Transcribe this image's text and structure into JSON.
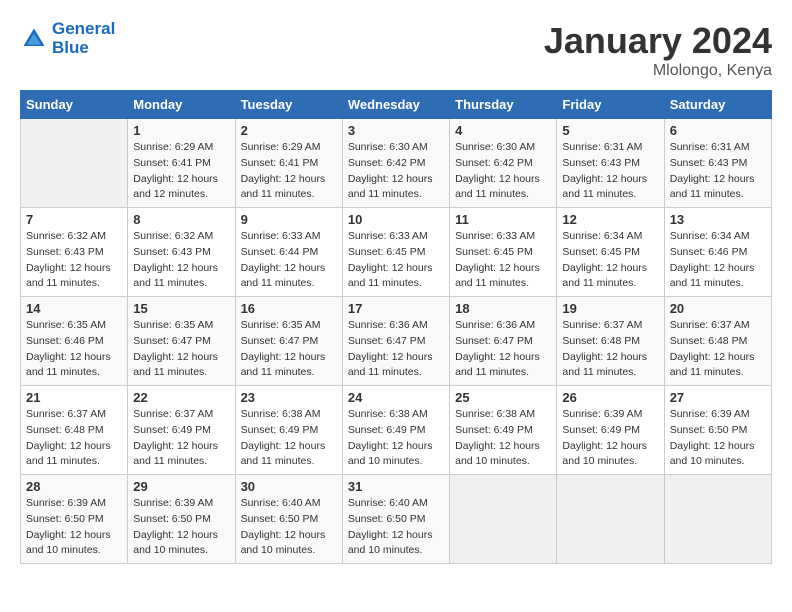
{
  "header": {
    "logo_line1": "General",
    "logo_line2": "Blue",
    "month": "January 2024",
    "location": "Mlolongo, Kenya"
  },
  "columns": [
    "Sunday",
    "Monday",
    "Tuesday",
    "Wednesday",
    "Thursday",
    "Friday",
    "Saturday"
  ],
  "weeks": [
    [
      {
        "day": "",
        "sunrise": "",
        "sunset": "",
        "daylight": ""
      },
      {
        "day": "1",
        "sunrise": "Sunrise: 6:29 AM",
        "sunset": "Sunset: 6:41 PM",
        "daylight": "Daylight: 12 hours and 12 minutes."
      },
      {
        "day": "2",
        "sunrise": "Sunrise: 6:29 AM",
        "sunset": "Sunset: 6:41 PM",
        "daylight": "Daylight: 12 hours and 11 minutes."
      },
      {
        "day": "3",
        "sunrise": "Sunrise: 6:30 AM",
        "sunset": "Sunset: 6:42 PM",
        "daylight": "Daylight: 12 hours and 11 minutes."
      },
      {
        "day": "4",
        "sunrise": "Sunrise: 6:30 AM",
        "sunset": "Sunset: 6:42 PM",
        "daylight": "Daylight: 12 hours and 11 minutes."
      },
      {
        "day": "5",
        "sunrise": "Sunrise: 6:31 AM",
        "sunset": "Sunset: 6:43 PM",
        "daylight": "Daylight: 12 hours and 11 minutes."
      },
      {
        "day": "6",
        "sunrise": "Sunrise: 6:31 AM",
        "sunset": "Sunset: 6:43 PM",
        "daylight": "Daylight: 12 hours and 11 minutes."
      }
    ],
    [
      {
        "day": "7",
        "sunrise": "Sunrise: 6:32 AM",
        "sunset": "Sunset: 6:43 PM",
        "daylight": "Daylight: 12 hours and 11 minutes."
      },
      {
        "day": "8",
        "sunrise": "Sunrise: 6:32 AM",
        "sunset": "Sunset: 6:43 PM",
        "daylight": "Daylight: 12 hours and 11 minutes."
      },
      {
        "day": "9",
        "sunrise": "Sunrise: 6:33 AM",
        "sunset": "Sunset: 6:44 PM",
        "daylight": "Daylight: 12 hours and 11 minutes."
      },
      {
        "day": "10",
        "sunrise": "Sunrise: 6:33 AM",
        "sunset": "Sunset: 6:45 PM",
        "daylight": "Daylight: 12 hours and 11 minutes."
      },
      {
        "day": "11",
        "sunrise": "Sunrise: 6:33 AM",
        "sunset": "Sunset: 6:45 PM",
        "daylight": "Daylight: 12 hours and 11 minutes."
      },
      {
        "day": "12",
        "sunrise": "Sunrise: 6:34 AM",
        "sunset": "Sunset: 6:45 PM",
        "daylight": "Daylight: 12 hours and 11 minutes."
      },
      {
        "day": "13",
        "sunrise": "Sunrise: 6:34 AM",
        "sunset": "Sunset: 6:46 PM",
        "daylight": "Daylight: 12 hours and 11 minutes."
      }
    ],
    [
      {
        "day": "14",
        "sunrise": "Sunrise: 6:35 AM",
        "sunset": "Sunset: 6:46 PM",
        "daylight": "Daylight: 12 hours and 11 minutes."
      },
      {
        "day": "15",
        "sunrise": "Sunrise: 6:35 AM",
        "sunset": "Sunset: 6:47 PM",
        "daylight": "Daylight: 12 hours and 11 minutes."
      },
      {
        "day": "16",
        "sunrise": "Sunrise: 6:35 AM",
        "sunset": "Sunset: 6:47 PM",
        "daylight": "Daylight: 12 hours and 11 minutes."
      },
      {
        "day": "17",
        "sunrise": "Sunrise: 6:36 AM",
        "sunset": "Sunset: 6:47 PM",
        "daylight": "Daylight: 12 hours and 11 minutes."
      },
      {
        "day": "18",
        "sunrise": "Sunrise: 6:36 AM",
        "sunset": "Sunset: 6:47 PM",
        "daylight": "Daylight: 12 hours and 11 minutes."
      },
      {
        "day": "19",
        "sunrise": "Sunrise: 6:37 AM",
        "sunset": "Sunset: 6:48 PM",
        "daylight": "Daylight: 12 hours and 11 minutes."
      },
      {
        "day": "20",
        "sunrise": "Sunrise: 6:37 AM",
        "sunset": "Sunset: 6:48 PM",
        "daylight": "Daylight: 12 hours and 11 minutes."
      }
    ],
    [
      {
        "day": "21",
        "sunrise": "Sunrise: 6:37 AM",
        "sunset": "Sunset: 6:48 PM",
        "daylight": "Daylight: 12 hours and 11 minutes."
      },
      {
        "day": "22",
        "sunrise": "Sunrise: 6:37 AM",
        "sunset": "Sunset: 6:49 PM",
        "daylight": "Daylight: 12 hours and 11 minutes."
      },
      {
        "day": "23",
        "sunrise": "Sunrise: 6:38 AM",
        "sunset": "Sunset: 6:49 PM",
        "daylight": "Daylight: 12 hours and 11 minutes."
      },
      {
        "day": "24",
        "sunrise": "Sunrise: 6:38 AM",
        "sunset": "Sunset: 6:49 PM",
        "daylight": "Daylight: 12 hours and 10 minutes."
      },
      {
        "day": "25",
        "sunrise": "Sunrise: 6:38 AM",
        "sunset": "Sunset: 6:49 PM",
        "daylight": "Daylight: 12 hours and 10 minutes."
      },
      {
        "day": "26",
        "sunrise": "Sunrise: 6:39 AM",
        "sunset": "Sunset: 6:49 PM",
        "daylight": "Daylight: 12 hours and 10 minutes."
      },
      {
        "day": "27",
        "sunrise": "Sunrise: 6:39 AM",
        "sunset": "Sunset: 6:50 PM",
        "daylight": "Daylight: 12 hours and 10 minutes."
      }
    ],
    [
      {
        "day": "28",
        "sunrise": "Sunrise: 6:39 AM",
        "sunset": "Sunset: 6:50 PM",
        "daylight": "Daylight: 12 hours and 10 minutes."
      },
      {
        "day": "29",
        "sunrise": "Sunrise: 6:39 AM",
        "sunset": "Sunset: 6:50 PM",
        "daylight": "Daylight: 12 hours and 10 minutes."
      },
      {
        "day": "30",
        "sunrise": "Sunrise: 6:40 AM",
        "sunset": "Sunset: 6:50 PM",
        "daylight": "Daylight: 12 hours and 10 minutes."
      },
      {
        "day": "31",
        "sunrise": "Sunrise: 6:40 AM",
        "sunset": "Sunset: 6:50 PM",
        "daylight": "Daylight: 12 hours and 10 minutes."
      },
      {
        "day": "",
        "sunrise": "",
        "sunset": "",
        "daylight": ""
      },
      {
        "day": "",
        "sunrise": "",
        "sunset": "",
        "daylight": ""
      },
      {
        "day": "",
        "sunrise": "",
        "sunset": "",
        "daylight": ""
      }
    ]
  ]
}
